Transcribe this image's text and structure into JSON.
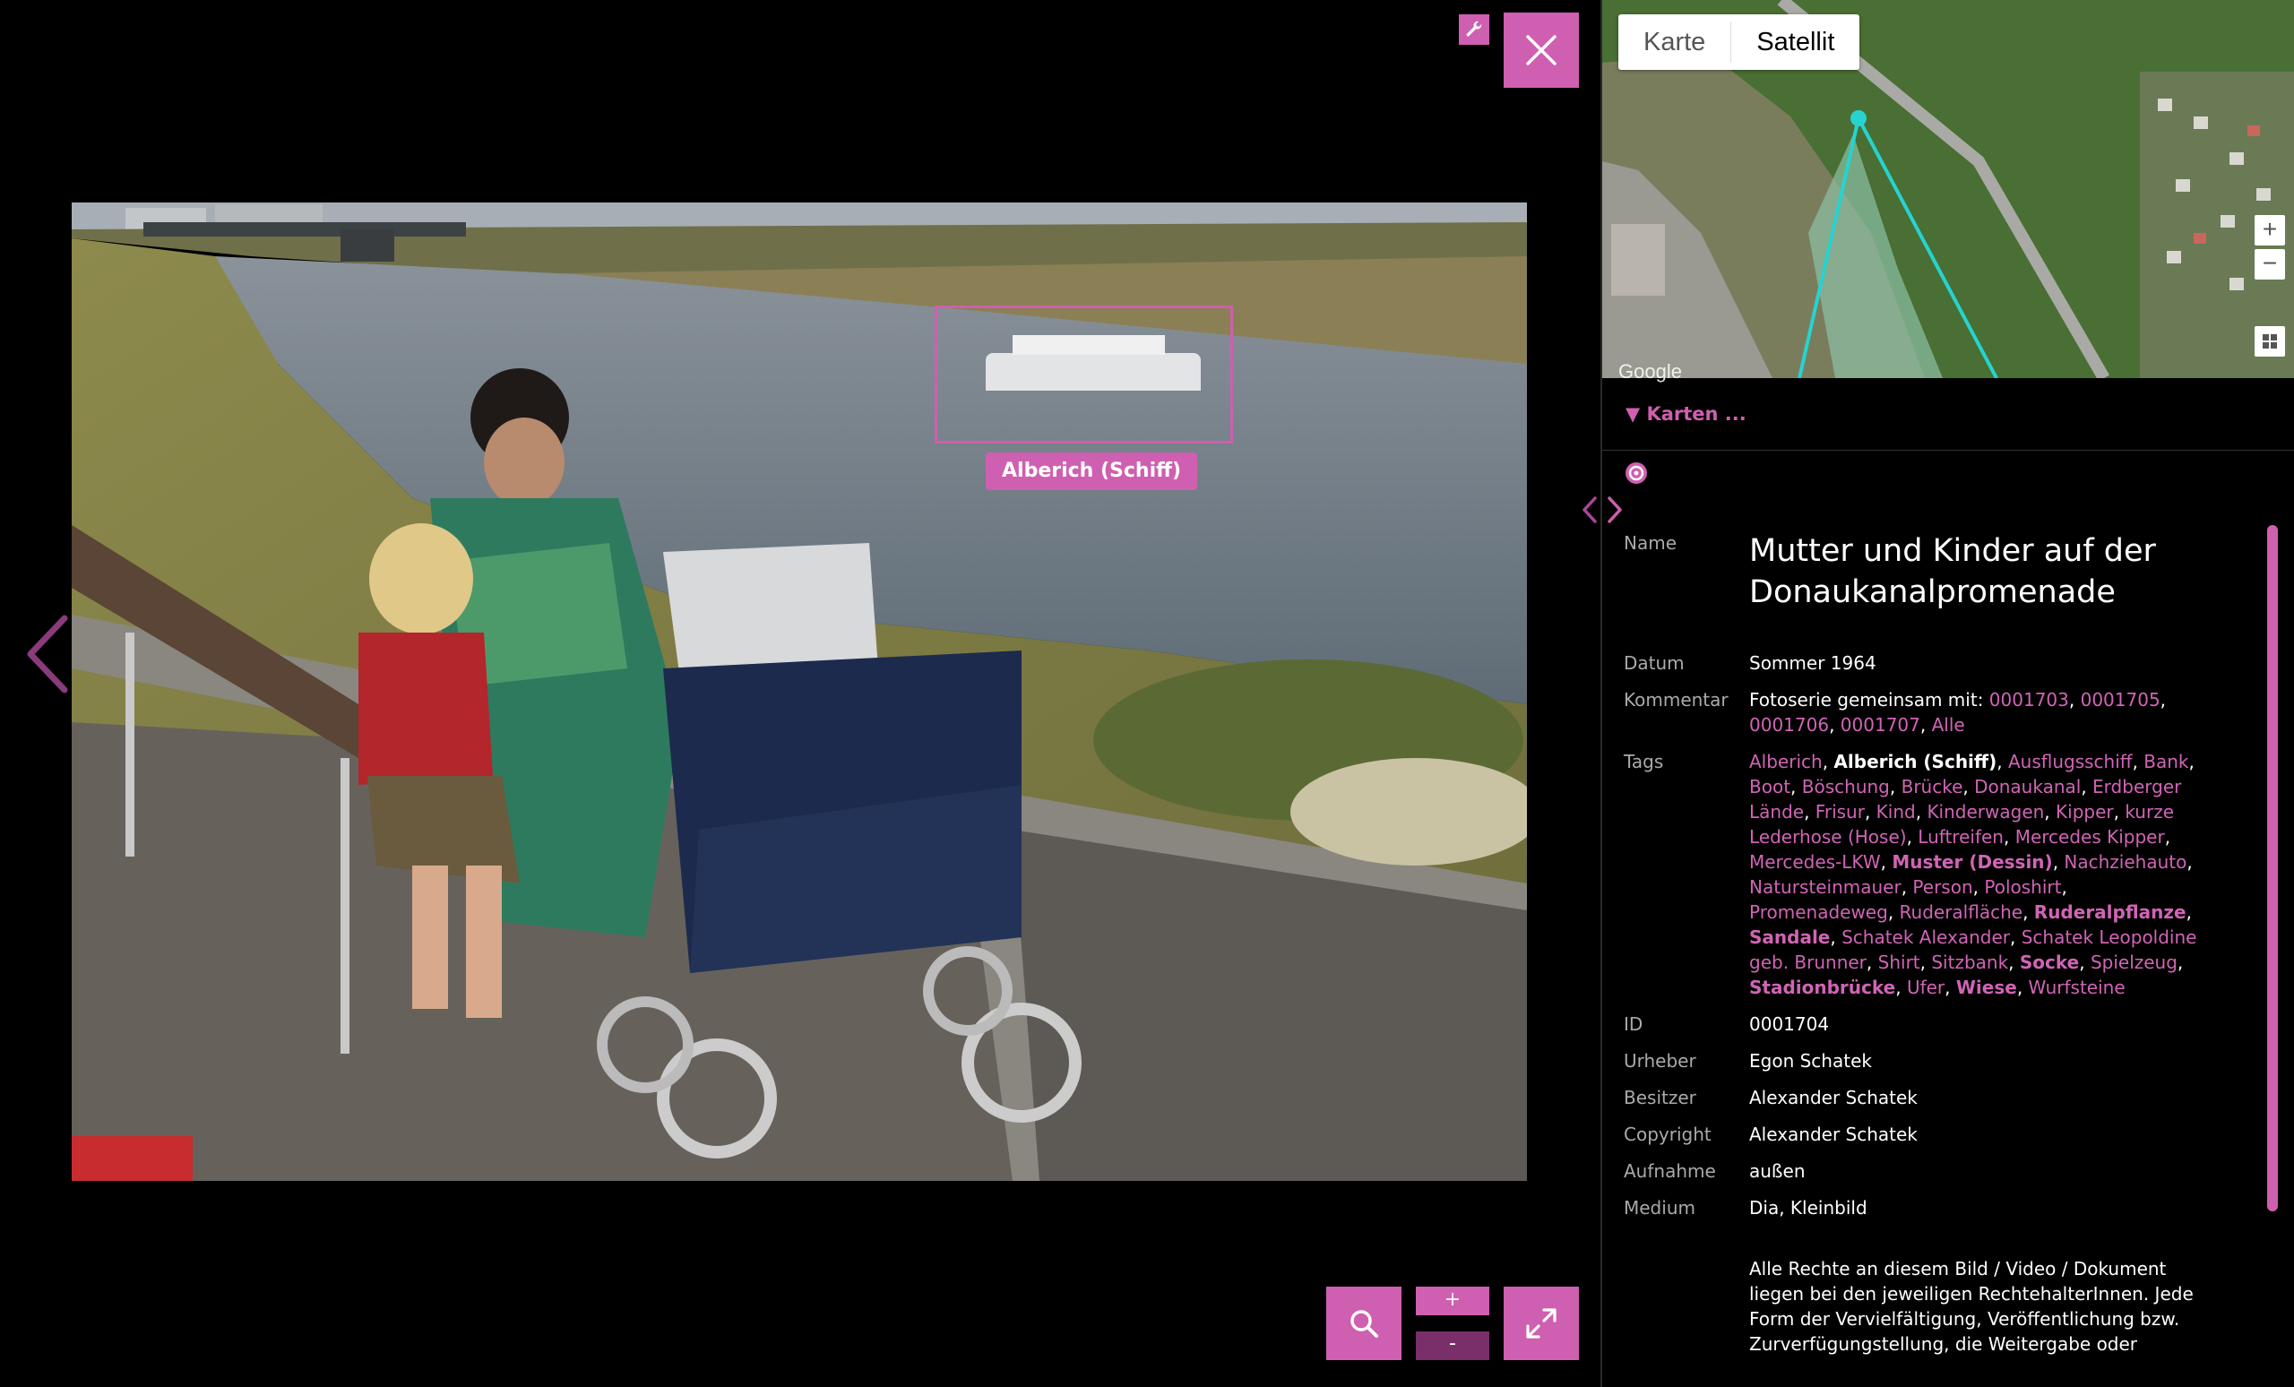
{
  "viewer": {
    "photo_tag": "Alberich (Schiff)",
    "zoom_in_label": "+",
    "zoom_out_label": "-"
  },
  "map": {
    "tabs": [
      "Karte",
      "Satellit"
    ],
    "active_tab": "Satellit",
    "zoom_in": "+",
    "zoom_out": "−",
    "attribution": "Google",
    "toggle_label": "▼ Karten ..."
  },
  "details": {
    "name_label": "Name",
    "name": "Mutter und Kinder auf der Donaukanalpromenade",
    "datum_label": "Datum",
    "datum": "Sommer 1964",
    "kommentar_label": "Kommentar",
    "kommentar_prefix": "Fotoserie gemeinsam mit: ",
    "kommentar_links": [
      "0001703",
      "0001705",
      "0001706",
      "0001707",
      "Alle"
    ],
    "tags_label": "Tags",
    "tags": [
      {
        "t": "Alberich",
        "s": "pink"
      },
      {
        "t": "Alberich (Schiff)",
        "s": "white-b"
      },
      {
        "t": "Ausflugsschiff",
        "s": "pink"
      },
      {
        "t": "Bank",
        "s": "pink"
      },
      {
        "t": "Boot",
        "s": "pink"
      },
      {
        "t": "Böschung",
        "s": "pink"
      },
      {
        "t": "Brücke",
        "s": "pink"
      },
      {
        "t": "Donaukanal",
        "s": "pink"
      },
      {
        "t": "Erdberger Lände",
        "s": "pink"
      },
      {
        "t": "Frisur",
        "s": "pink"
      },
      {
        "t": "Kind",
        "s": "pink"
      },
      {
        "t": "Kinderwagen",
        "s": "pink"
      },
      {
        "t": "Kipper",
        "s": "pink"
      },
      {
        "t": "kurze Lederhose (Hose)",
        "s": "pink"
      },
      {
        "t": "Luftreifen",
        "s": "pink"
      },
      {
        "t": "Mercedes Kipper",
        "s": "pink"
      },
      {
        "t": "Mercedes-LKW",
        "s": "pink"
      },
      {
        "t": "Muster (Dessin)",
        "s": "pink-b"
      },
      {
        "t": "Nachziehauto",
        "s": "pink"
      },
      {
        "t": "Natursteinmauer",
        "s": "pink"
      },
      {
        "t": "Person",
        "s": "pink"
      },
      {
        "t": "Poloshirt",
        "s": "pink"
      },
      {
        "t": "Promenadeweg",
        "s": "pink"
      },
      {
        "t": "Ruderalfläche",
        "s": "pink"
      },
      {
        "t": "Ruderalpflanze",
        "s": "pink-b"
      },
      {
        "t": "Sandale",
        "s": "pink-b"
      },
      {
        "t": "Schatek Alexander",
        "s": "pink"
      },
      {
        "t": "Schatek Leopoldine geb. Brunner",
        "s": "pink"
      },
      {
        "t": "Shirt",
        "s": "pink"
      },
      {
        "t": "Sitzbank",
        "s": "pink"
      },
      {
        "t": "Socke",
        "s": "pink-b"
      },
      {
        "t": "Spielzeug",
        "s": "pink"
      },
      {
        "t": "Stadionbrücke",
        "s": "pink-b"
      },
      {
        "t": "Ufer",
        "s": "pink"
      },
      {
        "t": "Wiese",
        "s": "pink-b"
      },
      {
        "t": "Wurfsteine",
        "s": "pink"
      }
    ],
    "id_label": "ID",
    "id": "0001704",
    "urheber_label": "Urheber",
    "urheber": "Egon Schatek",
    "besitzer_label": "Besitzer",
    "besitzer": "Alexander Schatek",
    "copyright_label": "Copyright",
    "copyright": "Alexander Schatek",
    "aufnahme_label": "Aufnahme",
    "aufnahme": "außen",
    "medium_label": "Medium",
    "medium": "Dia, Kleinbild",
    "rights_text": "Alle Rechte an diesem Bild / Video / Dokument liegen bei den jeweiligen RechtehalterInnen. Jede Form der Vervielfältigung, Veröffentlichung bzw. Zurverfügungstellung, die Weitergabe oder"
  },
  "colors": {
    "accent": "#cf5fb0",
    "background": "#000000"
  }
}
